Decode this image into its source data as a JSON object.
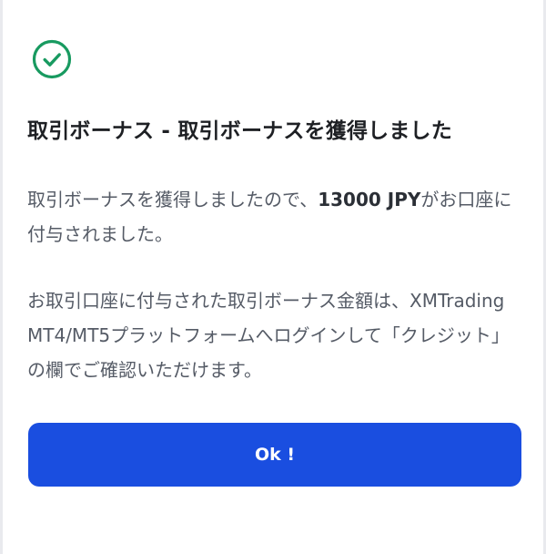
{
  "dialog": {
    "title": "取引ボーナス - 取引ボーナスを獲得しました",
    "message1": {
      "prefix": "取引ボーナスを獲得しましたので、",
      "amount": "13000 JPY",
      "suffix": "がお口座に付与されました。"
    },
    "message2": "お取引口座に付与された取引ボーナス金額は、XMTrading MT4/MT5プラットフォームへログインして「クレジット」の欄でご確認いただけます。",
    "ok_label": "Ok !"
  },
  "icons": {
    "status": "check-circle-icon"
  },
  "colors": {
    "success": "#189a60",
    "primary_button": "#1a4ee0",
    "title_text": "#1e2024",
    "body_text": "#555b66",
    "background": "#ffffff"
  }
}
